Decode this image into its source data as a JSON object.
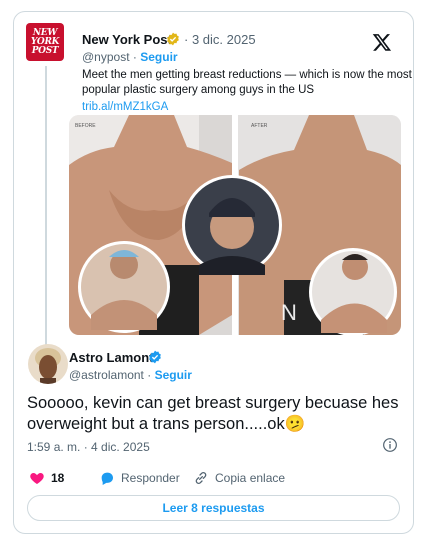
{
  "quoted": {
    "name": "New York Post",
    "logo_text": [
      "NEW",
      "YORK",
      "POST"
    ],
    "date": "· 3 dic. 2025",
    "handle": "@nypost",
    "follow": "Seguir",
    "text": "Meet the men getting breast reductions — which is now the most popular plastic surgery among guys in the US",
    "link": "trib.al/mMZ1kGA",
    "media": {
      "before_label": "BEFORE",
      "after_label": "AFTER",
      "watermark": "N"
    }
  },
  "reply": {
    "name": "Astro Lamont",
    "handle": "@astrolamont",
    "follow": "Seguir",
    "text": "Sooooo, kevin can get breast surgery becuase hes overweight but a trans person.....ok🫤",
    "timestamp": "1:59 a. m. · 4 dic. 2025"
  },
  "actions": {
    "like_count": "18",
    "reply_label": "Responder",
    "copy_label": "Copia enlace"
  },
  "read_replies": "Leer 8 respuestas",
  "icons": {
    "verified": "verified-badge-icon",
    "x_logo": "x-logo-icon",
    "info": "info-icon",
    "heart": "heart-icon",
    "reply": "reply-bubble-icon",
    "link": "link-icon"
  },
  "colors": {
    "accent": "#1d9bf0",
    "like": "#f91880",
    "brand_post": "#c8102e",
    "border": "#cfd9de",
    "muted": "#536471"
  }
}
